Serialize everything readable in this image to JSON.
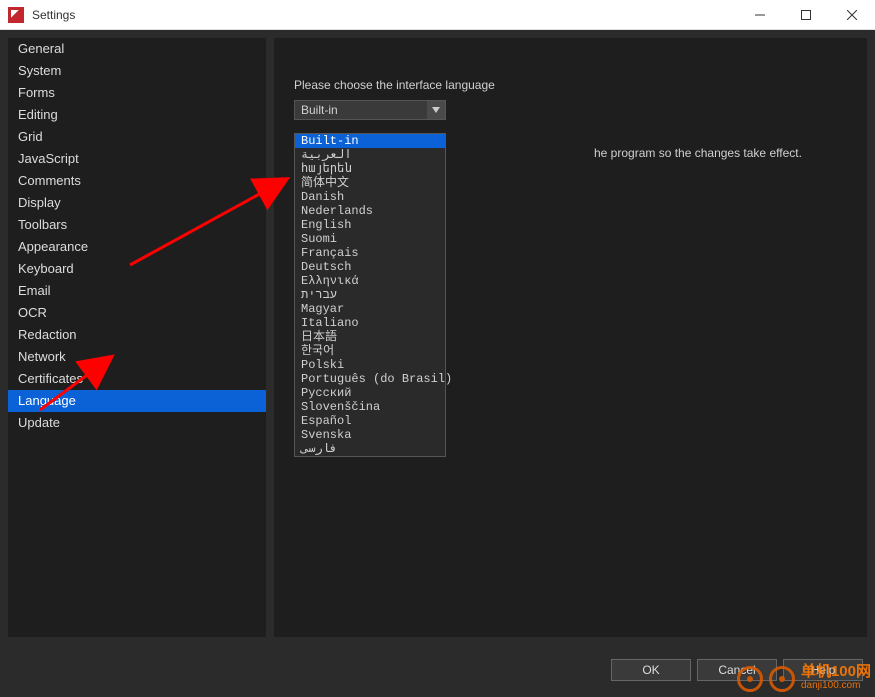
{
  "window": {
    "title": "Settings"
  },
  "sidebar": {
    "items": [
      {
        "label": "General"
      },
      {
        "label": "System"
      },
      {
        "label": "Forms"
      },
      {
        "label": "Editing"
      },
      {
        "label": "Grid"
      },
      {
        "label": "JavaScript"
      },
      {
        "label": "Comments"
      },
      {
        "label": "Display"
      },
      {
        "label": "Toolbars"
      },
      {
        "label": "Appearance"
      },
      {
        "label": "Keyboard"
      },
      {
        "label": "Email"
      },
      {
        "label": "OCR"
      },
      {
        "label": "Redaction"
      },
      {
        "label": "Network"
      },
      {
        "label": "Certificates"
      },
      {
        "label": "Language"
      },
      {
        "label": "Update"
      }
    ],
    "selected_index": 16
  },
  "content": {
    "prompt": "Please choose the interface language",
    "combo_value": "Built-in",
    "restart_note_tail": "he program so the changes take effect.",
    "dropdown": [
      "Built-in",
      "العربية",
      "հայերեն",
      "简体中文",
      "Danish",
      "Nederlands",
      "English",
      "Suomi",
      "Français",
      "Deutsch",
      "Ελληνικά",
      "עברית",
      "Magyar",
      "Italiano",
      "日本語",
      "한국어",
      "Polski",
      "Português (do Brasil)",
      "Русский",
      "Slovenščina",
      "Español",
      "Svenska",
      "فارسی"
    ],
    "dropdown_highlight_index": 0
  },
  "buttons": {
    "ok": "OK",
    "cancel": "Cancel",
    "help": "Help"
  },
  "watermark": {
    "name": "单机100网",
    "url": "danji100.com"
  }
}
